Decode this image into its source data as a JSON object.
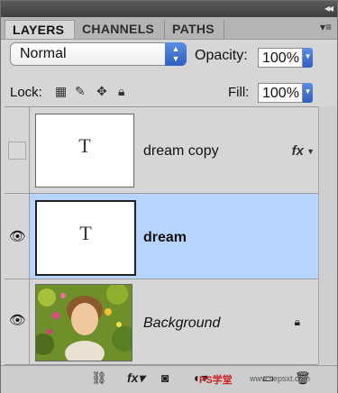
{
  "tabs": [
    {
      "label": "LAYERS",
      "active": true
    },
    {
      "label": "CHANNELS",
      "active": false
    },
    {
      "label": "PATHS",
      "active": false
    }
  ],
  "blend": {
    "value": "Normal"
  },
  "opacity": {
    "label": "Opacity:",
    "value": "100%"
  },
  "lock": {
    "label": "Lock:"
  },
  "fill": {
    "label": "Fill:",
    "value": "100%"
  },
  "layers": [
    {
      "name": "dream copy",
      "type": "text",
      "visible": false,
      "selected": false,
      "effects": "fx"
    },
    {
      "name": "dream",
      "type": "text",
      "visible": true,
      "selected": true
    },
    {
      "name": "Background",
      "type": "image",
      "visible": true,
      "selected": false,
      "locked": true
    }
  ],
  "thumb_text": "T",
  "watermark": {
    "text": "PS学堂",
    "url": "www.sepsxt.com"
  },
  "colors": {
    "selected_row": "#b7d4ff",
    "accent": "#2d5fc1"
  }
}
